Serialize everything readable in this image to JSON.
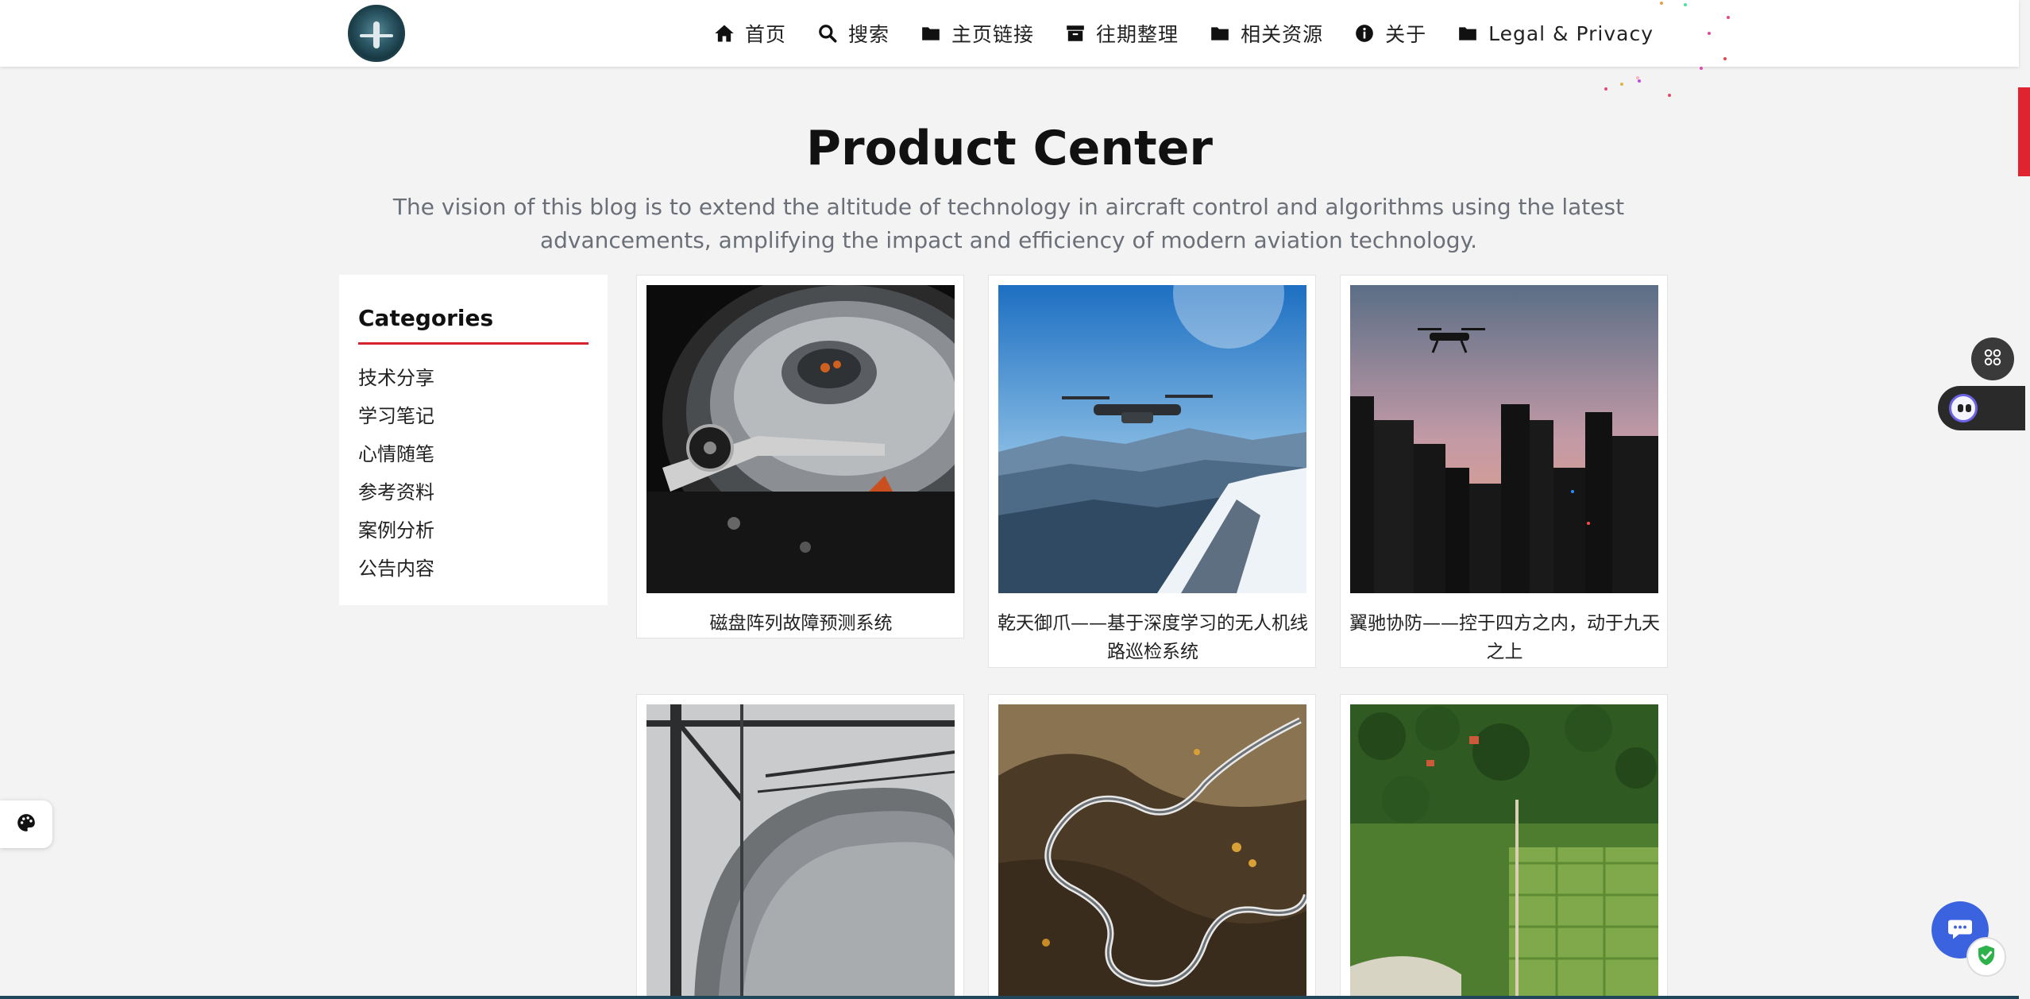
{
  "header": {
    "logo_alt": "logo",
    "nav": [
      {
        "label": "首页",
        "icon": "home-icon"
      },
      {
        "label": "搜索",
        "icon": "search-icon"
      },
      {
        "label": "主页链接",
        "icon": "folder-icon"
      },
      {
        "label": "往期整理",
        "icon": "archive-icon"
      },
      {
        "label": "相关资源",
        "icon": "folder-icon"
      },
      {
        "label": "关于",
        "icon": "info-icon"
      },
      {
        "label": "Legal & Privacy",
        "icon": "folder-icon"
      }
    ]
  },
  "hero": {
    "title": "Product Center",
    "subtitle": "The vision of this blog is to extend the altitude of technology in aircraft control and algorithms using the latest advancements, amplifying the impact and efficiency of modern aviation technology."
  },
  "sidebar": {
    "title": "Categories",
    "items": [
      {
        "label": "技术分享"
      },
      {
        "label": "学习笔记"
      },
      {
        "label": "心情随笔"
      },
      {
        "label": "参考资料"
      },
      {
        "label": "案例分析"
      },
      {
        "label": "公告内容"
      }
    ]
  },
  "products": [
    {
      "caption": "磁盘阵列故障预测系统",
      "image": "hard-drive-photo"
    },
    {
      "caption": "乾天御爪——基于深度学习的无人机线路巡检系统",
      "image": "drone-over-mountains-photo"
    },
    {
      "caption": "翼驰协防——控于四方之内，动于九天之上",
      "image": "drone-over-city-photo"
    },
    {
      "caption": "",
      "image": "industrial-tank-photo"
    },
    {
      "caption": "",
      "image": "winding-road-aerial-photo"
    },
    {
      "caption": "",
      "image": "green-fields-aerial-photo"
    }
  ],
  "colors": {
    "accent": "#d7232e",
    "chat_button": "#3b63e0",
    "subtitle_gray": "#6a6f78"
  }
}
